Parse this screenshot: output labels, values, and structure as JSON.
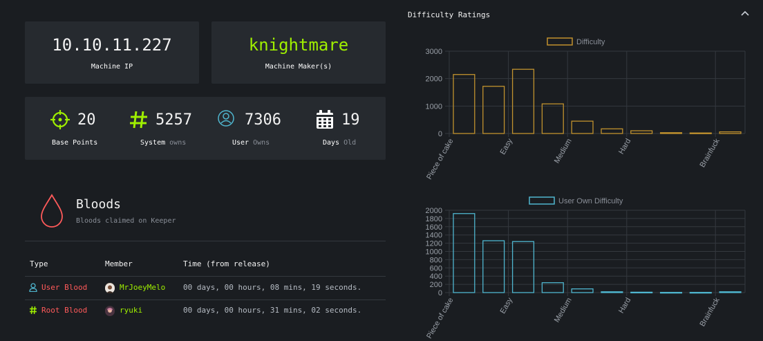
{
  "machine_ip": {
    "value": "10.10.11.227",
    "label": "Machine IP"
  },
  "machine_maker": {
    "value": "knightmare",
    "label": "Machine Maker(s)"
  },
  "stats": {
    "base_points": {
      "value": "20",
      "label": "Base Points"
    },
    "system_owns": {
      "value": "5257",
      "label": "System",
      "label_muted": "owns"
    },
    "user_owns": {
      "value": "7306",
      "label": "User",
      "label_muted": "Owns"
    },
    "days_old": {
      "value": "19",
      "label": "Days",
      "label_muted": "Old"
    }
  },
  "bloods": {
    "title": "Bloods",
    "subtitle": "Bloods claimed on Keeper",
    "columns": [
      "Type",
      "Member",
      "Time (from release)"
    ],
    "rows": [
      {
        "type": "User Blood",
        "member": "MrJoeyMelo",
        "time": "00 days, 00 hours, 08 mins, 19 seconds."
      },
      {
        "type": "Root Blood",
        "member": "ryuki",
        "time": "00 days, 00 hours, 31 mins, 02 seconds."
      }
    ]
  },
  "panel": {
    "title": "Difficulty Ratings"
  },
  "chart_data": [
    {
      "type": "bar",
      "series": [
        {
          "name": "Difficulty",
          "color": "#c1922e",
          "values": [
            2150,
            1720,
            2340,
            1080,
            450,
            170,
            100,
            30,
            20,
            60
          ]
        }
      ],
      "categories": [
        "Piece of cake",
        "",
        "Easy",
        "",
        "Medium",
        "",
        "Hard",
        "",
        "",
        "Brainfuck"
      ],
      "yticks": [
        0,
        1000,
        2000,
        3000
      ],
      "ylim": [
        0,
        3000
      ],
      "legend": "top"
    },
    {
      "type": "bar",
      "series": [
        {
          "name": "User Own Difficulty",
          "color": "#4fb6cf",
          "values": [
            1920,
            1260,
            1240,
            240,
            90,
            20,
            10,
            5,
            5,
            20
          ]
        }
      ],
      "categories": [
        "Piece of cake",
        "",
        "Easy",
        "",
        "Medium",
        "",
        "Hard",
        "",
        "",
        "Brainfuck"
      ],
      "yticks": [
        0,
        200,
        400,
        600,
        800,
        1000,
        1200,
        1400,
        1600,
        1800,
        2000
      ],
      "ylim": [
        0,
        2000
      ],
      "legend": "top"
    }
  ]
}
